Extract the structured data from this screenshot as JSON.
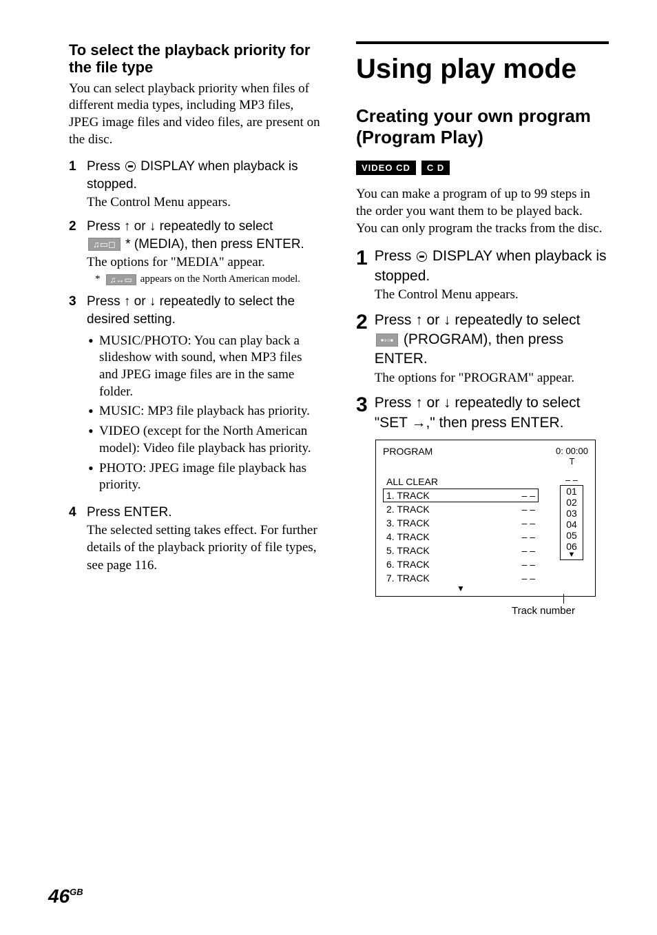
{
  "left": {
    "heading3": "To select the playback priority for the file type",
    "intro": "You can select playback priority when files of different media types, including MP3 files, JPEG image files and video files, are present on the disc.",
    "steps": [
      {
        "num": "1",
        "head_pre": "Press ",
        "head_post": " DISPLAY when playback is stopped.",
        "sub": "The Control Menu appears."
      },
      {
        "num": "2",
        "head_line1_pre": "Press ",
        "head_line1_mid": " or ",
        "head_line1_post": " repeatedly to select",
        "head_line2_post": " * (MEDIA), then press ENTER.",
        "sub": "The options for \"MEDIA\" appear.",
        "footnote_pre": "*",
        "footnote_post": " appears on the North American model."
      },
      {
        "num": "3",
        "head_pre": "Press ",
        "head_mid": " or ",
        "head_post": " repeatedly to select the desired setting.",
        "bullets": [
          "MUSIC/PHOTO: You can play back a slideshow with sound, when MP3 files and JPEG image files are in the same folder.",
          "MUSIC: MP3 file playback has priority.",
          "VIDEO (except for the North American model): Video file playback has priority.",
          "PHOTO: JPEG image file playback has priority."
        ]
      },
      {
        "num": "4",
        "head": "Press ENTER.",
        "sub": "The selected setting takes effect. For further details of the playback priority of file types, see page 116."
      }
    ]
  },
  "right": {
    "h1": "Using play mode",
    "h2": "Creating your own program (Program Play)",
    "badges": [
      "VIDEO CD",
      "C D"
    ],
    "intro1": "You can make a program of up to 99 steps in the order you want them to be played back.",
    "intro2": "You can only program the tracks from the disc.",
    "steps": [
      {
        "num": "1",
        "head_pre": "Press ",
        "head_post": " DISPLAY when playback is stopped.",
        "sub": "The Control Menu appears."
      },
      {
        "num": "2",
        "head_line1_pre": "Press ",
        "head_line1_mid": " or ",
        "head_line1_post": " repeatedly to select",
        "head_line2_post": " (PROGRAM), then press ENTER.",
        "sub": "The options for \"PROGRAM\" appear."
      },
      {
        "num": "3",
        "head_pre": "Press ",
        "head_mid": " or ",
        "head_post": " repeatedly to select \"SET ",
        "head_tail": ",\" then press ENTER."
      }
    ],
    "figure": {
      "title": "PROGRAM",
      "time": "0: 00:00",
      "t_label": "T",
      "rows": [
        {
          "label": "ALL CLEAR",
          "val": ""
        },
        {
          "label": "1. TRACK",
          "val": "– –",
          "selected": true
        },
        {
          "label": "2. TRACK",
          "val": "– –"
        },
        {
          "label": "3. TRACK",
          "val": "– –"
        },
        {
          "label": "4. TRACK",
          "val": "– –"
        },
        {
          "label": "5. TRACK",
          "val": "– –"
        },
        {
          "label": "6. TRACK",
          "val": "– –"
        },
        {
          "label": "7. TRACK",
          "val": "– –"
        }
      ],
      "right_top": "– –",
      "right_values": [
        "01",
        "02",
        "03",
        "04",
        "05",
        "06"
      ],
      "caption": "Track number"
    }
  },
  "page": {
    "num": "46",
    "sup": "GB"
  }
}
